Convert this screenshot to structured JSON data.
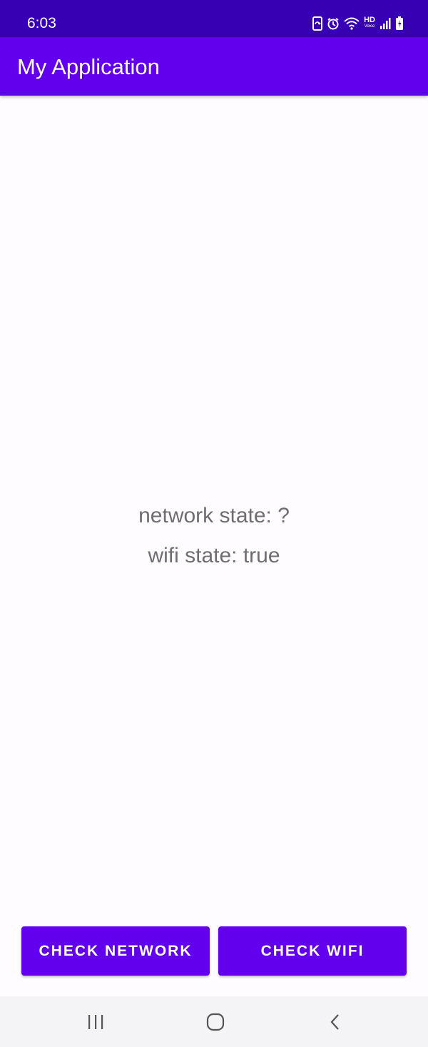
{
  "status_bar": {
    "time": "6:03",
    "icons": [
      "sync-icon",
      "alarm-icon",
      "wifi-icon",
      "hd-voice-icon",
      "signal-icon",
      "battery-charging-icon"
    ],
    "hd_text": "HD",
    "voice_text": "Voice"
  },
  "app_bar": {
    "title": "My Application",
    "color": "#6200ee",
    "status_color": "#3700b3"
  },
  "main": {
    "network_state": "network state: ?",
    "wifi_state": "wifi state: true"
  },
  "buttons": {
    "check_network": "CHECK NETWORK",
    "check_wifi": "CHECK WIFI"
  },
  "nav_bar": {
    "items": [
      "recents-icon",
      "home-icon",
      "back-icon"
    ]
  }
}
